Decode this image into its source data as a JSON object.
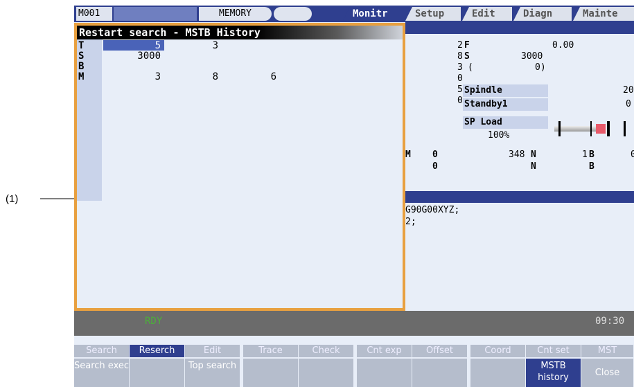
{
  "topbar": {
    "machine": "M001",
    "mode": "MEMORY",
    "tabs": [
      "Monitr",
      "Setup",
      "Edit",
      "Diagn",
      "Mainte"
    ]
  },
  "popup": {
    "title": "Restart search - MSTB History",
    "rows": [
      {
        "label": "T",
        "values": [
          "5",
          "3"
        ]
      },
      {
        "label": "S",
        "values": [
          "3000"
        ]
      },
      {
        "label": "B",
        "values": []
      },
      {
        "label": "M",
        "values": [
          "3",
          "8",
          "6"
        ]
      }
    ]
  },
  "monitor": {
    "digits": [
      "2",
      "8",
      "3",
      "0",
      "5",
      "0"
    ],
    "f_label": "F",
    "f_value": "0.00",
    "s_label": "S",
    "s_value": "3000",
    "paren_open": "(",
    "paren_value": "0)",
    "spindle_label": "Spindle",
    "spindle_value": "20",
    "standby_label": "Standby1",
    "standby_value": "0",
    "spload_label": "SP Load",
    "spload_pct": "100%",
    "row1": {
      "m": "M",
      "o": "0",
      "v348": "348",
      "n": "N",
      "v1": "1",
      "b": "B",
      "v0": "0"
    },
    "row2": {
      "o": "0",
      "n": "N",
      "b": "B"
    },
    "program_lines": [
      "G90G00XYZ;",
      "2;"
    ]
  },
  "status": {
    "ready": "RDY",
    "time": "09:30"
  },
  "menu_keys": [
    "Search",
    "Reserch",
    "Edit",
    "Trace",
    "Check",
    "Cnt exp",
    "Offset",
    "Coord",
    "Cnt set",
    "MST"
  ],
  "soft_keys": [
    "Search exec",
    "",
    "Top search",
    "",
    "",
    "",
    "",
    "",
    "MSTB history",
    "Close"
  ],
  "callout": "(1)",
  "colors": {
    "accent": "#2f3f8f",
    "popup_border": "#e8a040",
    "ready": "#4caf3a",
    "cursor": "#4a63b8"
  }
}
